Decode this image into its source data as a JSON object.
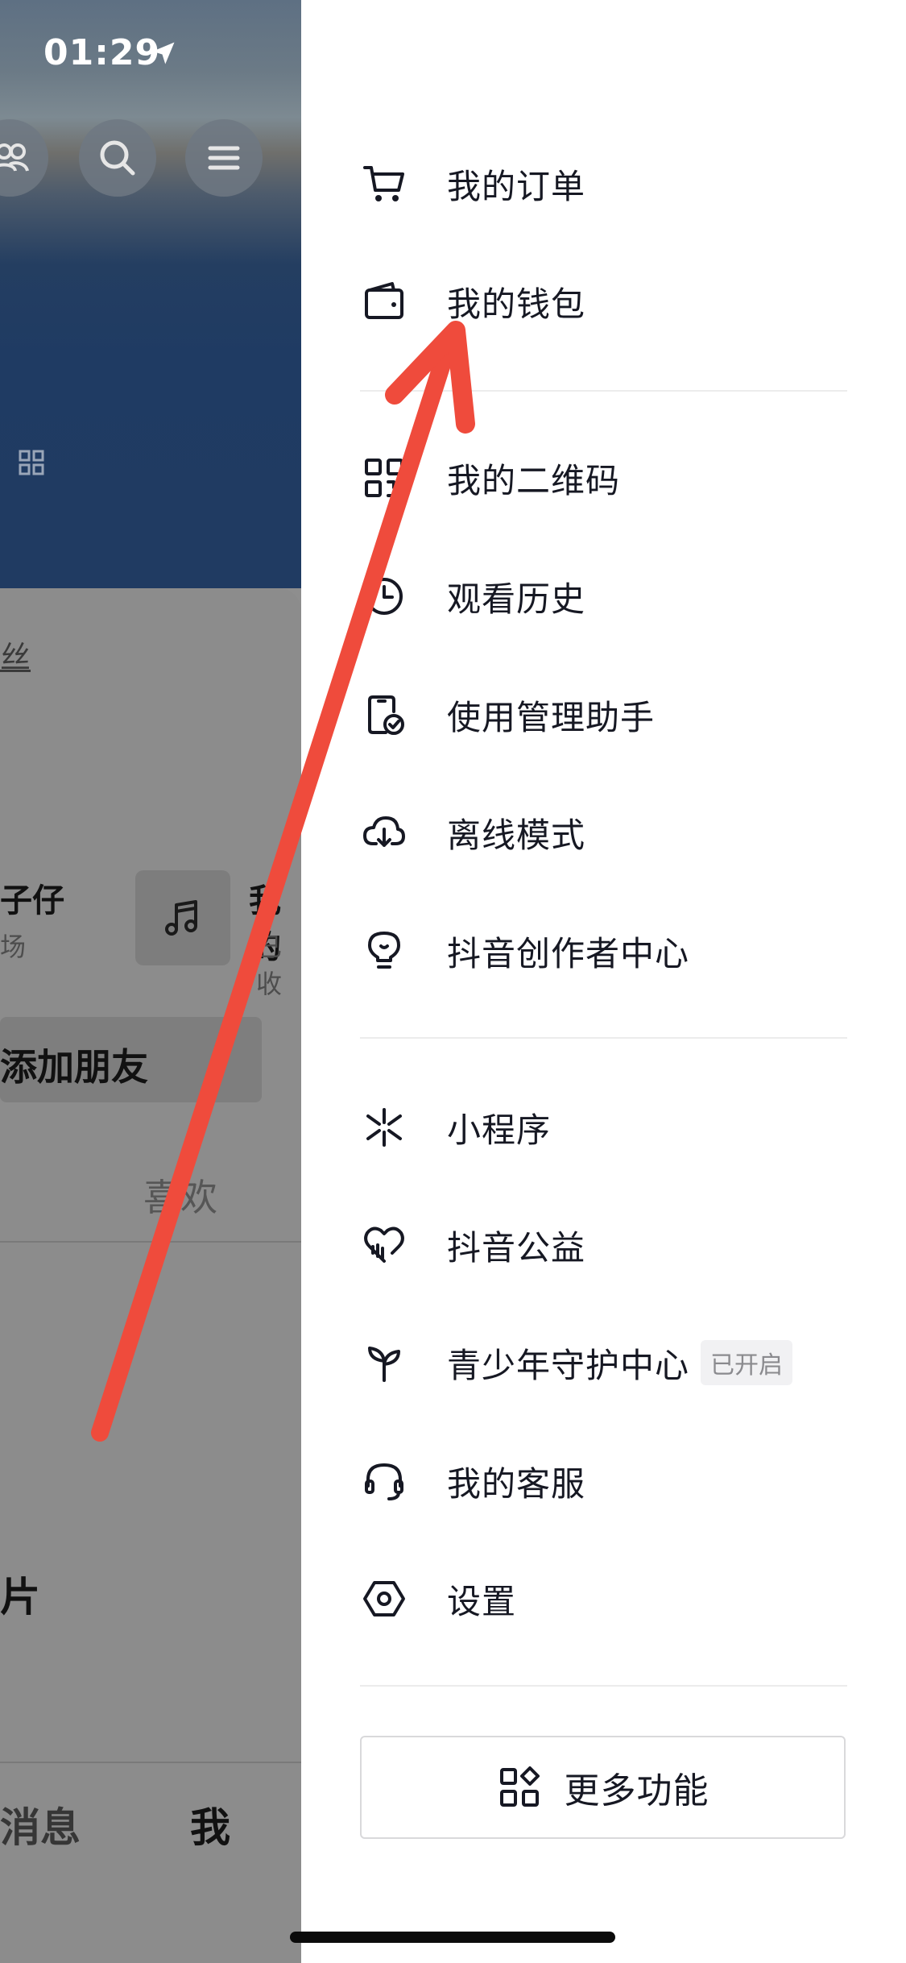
{
  "status_bar": {
    "time": "01:29"
  },
  "profile_bg": {
    "fans_label": "丝",
    "tile_left": {
      "title": "子仔",
      "subtitle": "场"
    },
    "tile_right": {
      "title": "我的",
      "subtitle": "已收"
    },
    "add_friend_label": "添加朋友",
    "likes_tab_label": "喜欢",
    "section_label": "片",
    "bottom_nav": {
      "messages": "消息",
      "me": "我"
    }
  },
  "drawer": {
    "group1": [
      {
        "label": "我的订单",
        "icon": "cart-icon"
      },
      {
        "label": "我的钱包",
        "icon": "wallet-icon"
      }
    ],
    "group2": [
      {
        "label": "我的二维码",
        "icon": "qr-code-icon"
      },
      {
        "label": "观看历史",
        "icon": "clock-icon"
      },
      {
        "label": "使用管理助手",
        "icon": "phone-check-icon"
      },
      {
        "label": "离线模式",
        "icon": "cloud-download-icon"
      },
      {
        "label": "抖音创作者中心",
        "icon": "lightbulb-icon"
      }
    ],
    "group3": [
      {
        "label": "小程序",
        "icon": "mini-program-icon"
      },
      {
        "label": "抖音公益",
        "icon": "heart-icon"
      },
      {
        "label": "青少年守护中心",
        "icon": "sprout-icon",
        "badge": "已开启"
      },
      {
        "label": "我的客服",
        "icon": "headset-icon"
      },
      {
        "label": "设置",
        "icon": "settings-hexagon-icon"
      }
    ],
    "more_button": {
      "label": "更多功能",
      "icon": "grid-plus-icon"
    }
  },
  "colors": {
    "annotation_arrow": "#ef4b3c",
    "text_primary": "#161823"
  }
}
